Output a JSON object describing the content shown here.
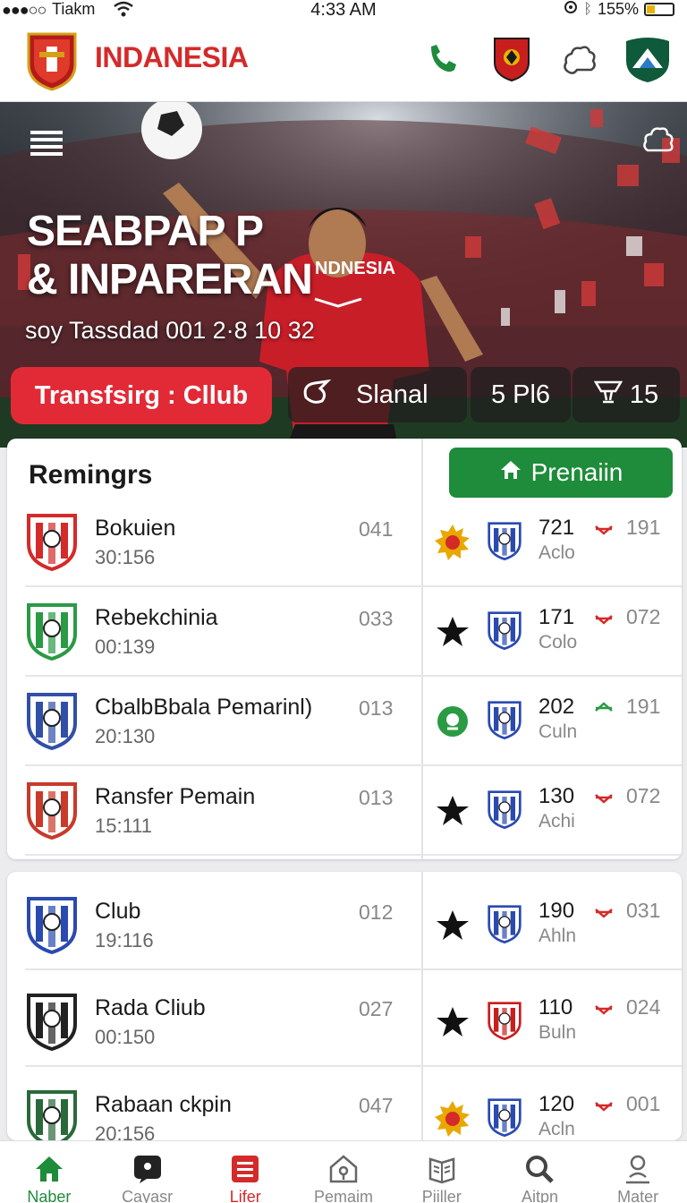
{
  "status": {
    "dots": "●●●○○",
    "carrier": "Tiakm",
    "time": "4:33 AM",
    "battery": "155%"
  },
  "header": {
    "brand": "INDANESIA"
  },
  "hero": {
    "title_line1": "SEABPAP P",
    "title_line2": "& INPARERAN",
    "subtitle": "soy Tassdad 001 2·8 10 32",
    "cta": "Transfsirg : Cllub",
    "stat1": "Slanal",
    "stat2": "5 Pl6",
    "stat3": "15",
    "jersey_text": "NDNESIA"
  },
  "section": {
    "title": "Remingrs",
    "primary_button": "Prenaiin"
  },
  "rows_card1": [
    {
      "name": "Bokuien",
      "time": "30:156",
      "code": "041",
      "num": "721",
      "sub": "Aclo",
      "tval": "191",
      "trend": "down",
      "icon": "sun-badge-icon",
      "crest_color": "#d42a2a"
    },
    {
      "name": "Rebekchinia",
      "time": "00:139",
      "code": "033",
      "num": "171",
      "sub": "Colo",
      "tval": "072",
      "trend": "down",
      "icon": "star-icon",
      "crest_color": "#2a9a44"
    },
    {
      "name": "CbalbBbala Pemarinl)",
      "time": "20:130",
      "code": "013",
      "num": "202",
      "sub": "Culn",
      "tval": "191",
      "trend": "up",
      "icon": "whistle-icon",
      "crest_color": "#3050a8"
    },
    {
      "name": "Ransfer Pemain",
      "time": "15:111",
      "code": "013",
      "num": "130",
      "sub": "Achi",
      "tval": "072",
      "trend": "down",
      "icon": "star-icon",
      "crest_color": "#c83a2a"
    }
  ],
  "rows_card2": [
    {
      "name": "Club",
      "time": "19:116",
      "code": "012",
      "num": "190",
      "sub": "Ahln",
      "tval": "031",
      "trend": "down",
      "icon": "star-icon",
      "crest_color": "#2a4ab0"
    },
    {
      "name": "Rada Cliub",
      "time": "00:150",
      "code": "027",
      "num": "110",
      "sub": "Buln",
      "tval": "024",
      "trend": "down",
      "icon": "star-icon",
      "crest_color": "#222222"
    },
    {
      "name": "Rabaan ckpin",
      "time": "20:156",
      "code": "047",
      "num": "120",
      "sub": "Acln",
      "tval": "001",
      "trend": "down",
      "icon": "sun-badge-icon",
      "crest_color": "#2a6a3a"
    }
  ],
  "nav": [
    {
      "label": "Naber",
      "icon": "home-icon"
    },
    {
      "label": "Cayasr",
      "icon": "chat-icon"
    },
    {
      "label": "Lifer",
      "icon": "list-icon"
    },
    {
      "label": "Pemaim",
      "icon": "house-outline-icon"
    },
    {
      "label": "Piiller",
      "icon": "book-icon"
    },
    {
      "label": "Aitpn",
      "icon": "search-icon"
    },
    {
      "label": "Mater",
      "icon": "user-icon"
    }
  ],
  "colors": {
    "brand_red": "#d42a2a",
    "accent_green": "#1e8c3a",
    "up_green": "#2a9a44"
  }
}
